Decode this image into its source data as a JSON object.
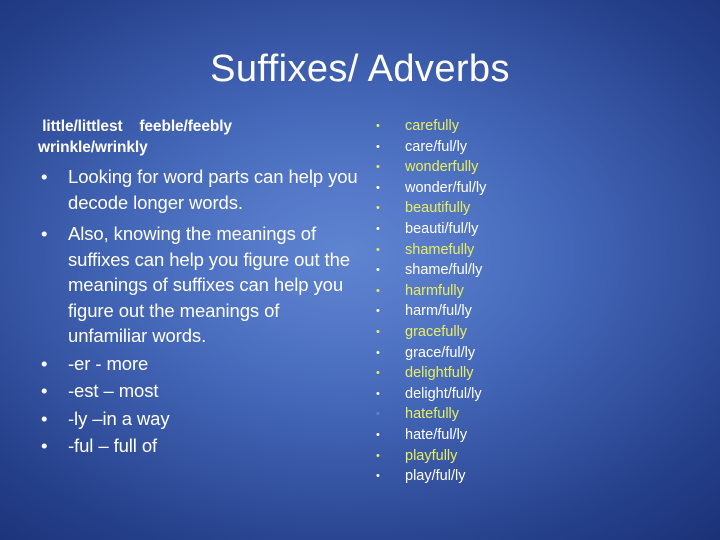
{
  "slide": {
    "title": "Suffixes/ Adverbs",
    "background": {
      "center_color": "#5f84d0",
      "edge_color": "#1b3176"
    }
  },
  "left_column": {
    "plain_lines": [
      " little/littlest    feeble/feebly",
      "wrinkle/wrinkly"
    ],
    "bullets": [
      {
        "text": "Looking for word parts can help you decode longer words."
      },
      {
        "text": "Also, knowing the meanings of suffixes can help you figure out the meanings of suffixes can help you figure out the meanings of unfamiliar words."
      },
      {
        "text": "-er  - more"
      },
      {
        "text": "-est – most"
      },
      {
        "text": "-ly –in a way"
      },
      {
        "text": "-ful – full of"
      }
    ]
  },
  "right_column": {
    "bullet_glyph": "•",
    "word_color": "#e9ef5d",
    "split_color": "#ffffff",
    "items": [
      {
        "text": "carefully",
        "style": "word",
        "faint_bullet": false
      },
      {
        "text": "care/ful/ly",
        "style": "split",
        "faint_bullet": false
      },
      {
        "text": "wonderfully",
        "style": "word",
        "faint_bullet": false
      },
      {
        "text": "wonder/ful/ly",
        "style": "split",
        "faint_bullet": false
      },
      {
        "text": "beautifully",
        "style": "word",
        "faint_bullet": false
      },
      {
        "text": "beauti/ful/ly",
        "style": "split",
        "faint_bullet": false
      },
      {
        "text": "shamefully",
        "style": "word",
        "faint_bullet": false
      },
      {
        "text": "shame/ful/ly",
        "style": "split",
        "faint_bullet": false
      },
      {
        "text": "harmfully",
        "style": "word",
        "faint_bullet": false
      },
      {
        "text": "harm/ful/ly",
        "style": "split",
        "faint_bullet": false
      },
      {
        "text": "gracefully",
        "style": "word",
        "faint_bullet": false
      },
      {
        "text": "grace/ful/ly",
        "style": "split",
        "faint_bullet": false
      },
      {
        "text": "delightfully",
        "style": "word",
        "faint_bullet": false
      },
      {
        "text": "delight/ful/ly",
        "style": "split",
        "faint_bullet": false
      },
      {
        "text": "hatefully",
        "style": "word",
        "faint_bullet": true
      },
      {
        "text": "hate/ful/ly",
        "style": "split",
        "faint_bullet": false
      },
      {
        "text": "playfully",
        "style": "word",
        "faint_bullet": false
      },
      {
        "text": "play/ful/ly",
        "style": "split",
        "faint_bullet": false
      }
    ]
  },
  "bullet_glyph": "•"
}
